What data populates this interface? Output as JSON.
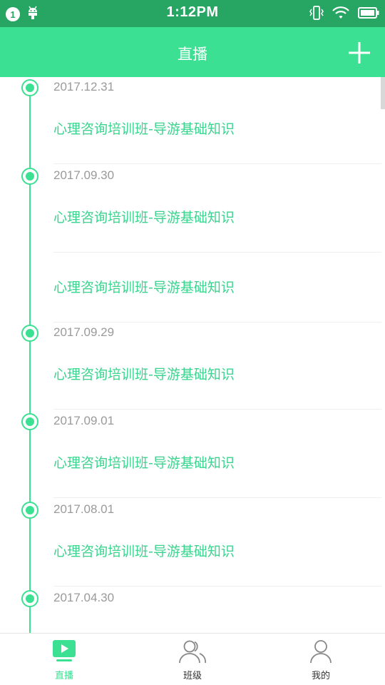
{
  "status_bar": {
    "notification_count": "1",
    "time": "1:12PM"
  },
  "header": {
    "title": "直播",
    "add_icon": "plus-icon"
  },
  "timeline": [
    {
      "date": "2017.12.31",
      "courses": [
        "心理咨询培训班-导游基础知识"
      ]
    },
    {
      "date": "2017.09.30",
      "courses": [
        "心理咨询培训班-导游基础知识",
        "心理咨询培训班-导游基础知识"
      ]
    },
    {
      "date": "2017.09.29",
      "courses": [
        "心理咨询培训班-导游基础知识"
      ]
    },
    {
      "date": "2017.09.01",
      "courses": [
        "心理咨询培训班-导游基础知识"
      ]
    },
    {
      "date": "2017.08.01",
      "courses": [
        "心理咨询培训班-导游基础知识"
      ]
    },
    {
      "date": "2017.04.30",
      "courses": []
    }
  ],
  "tabs": [
    {
      "label": "直播",
      "icon": "live-play-icon",
      "active": true
    },
    {
      "label": "班级",
      "icon": "class-users-icon",
      "active": false
    },
    {
      "label": "我的",
      "icon": "profile-user-icon",
      "active": false
    }
  ],
  "colors": {
    "status_bar": "#27a563",
    "accent": "#3be092",
    "course_text": "#3bd48e",
    "date_text": "#9a9a9a"
  }
}
